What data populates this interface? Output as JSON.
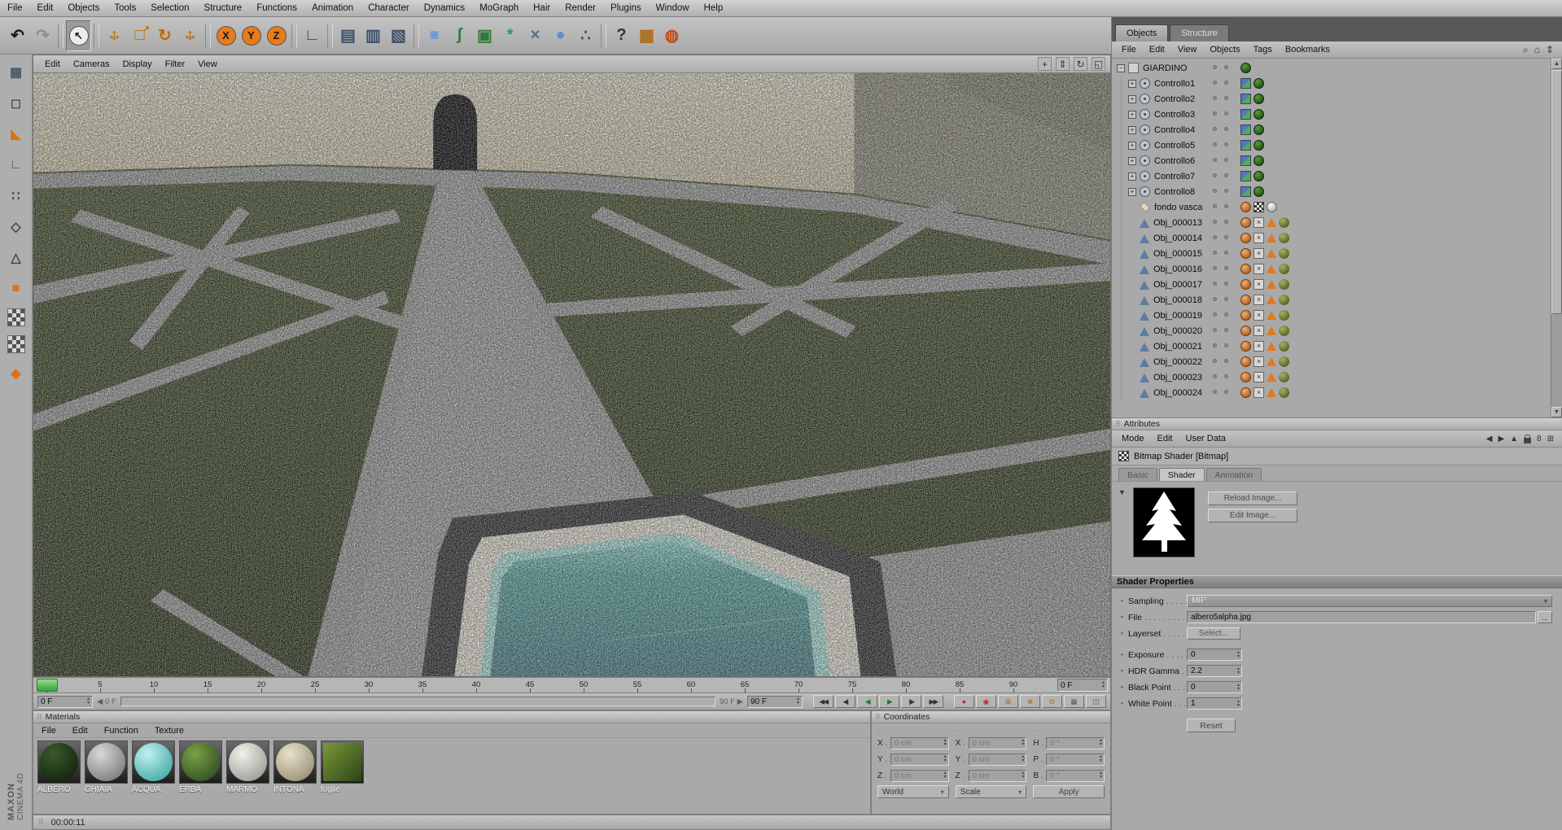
{
  "accent_colors": {
    "orange": "#e87b1a",
    "ui_gray": "#aeaeae",
    "playhead_green": "#62c862"
  },
  "menubar": {
    "items": [
      "File",
      "Edit",
      "Objects",
      "Tools",
      "Selection",
      "Structure",
      "Functions",
      "Animation",
      "Character",
      "Dynamics",
      "MoGraph",
      "Hair",
      "Render",
      "Plugins",
      "Window",
      "Help"
    ]
  },
  "toolbar": {
    "icons": [
      {
        "name": "undo-icon",
        "g": "↶",
        "fg": "#1a1a1a"
      },
      {
        "name": "redo-icon",
        "g": "↷",
        "fg": "#8d8d8d"
      },
      {
        "sep": true
      },
      {
        "name": "live-selection-tool",
        "g": "↖",
        "fg": "#1a1a1a",
        "circle": "#ececec",
        "sel": true
      },
      {
        "sep": true
      },
      {
        "name": "move-tool",
        "g": "↔",
        "g2": "↕",
        "fg": "#c26a00"
      },
      {
        "name": "scale-tool",
        "g": "□",
        "g2": "↗",
        "g2small": true,
        "fg": "#c26a00"
      },
      {
        "name": "rotate-tool",
        "g": "↻",
        "fg": "#c26a00"
      },
      {
        "name": "last-used-tool",
        "g": "↔",
        "g2": "↕",
        "fg": "#c26a00"
      },
      {
        "sep": true
      },
      {
        "name": "x-axis-lock",
        "g": "X",
        "fg": "#1a1a1a",
        "circle": "#e87b1a"
      },
      {
        "name": "y-axis-lock",
        "g": "Y",
        "fg": "#1a1a1a",
        "circle": "#e87b1a"
      },
      {
        "name": "z-axis-lock",
        "g": "Z",
        "fg": "#1a1a1a",
        "circle": "#e87b1a"
      },
      {
        "sep": true
      },
      {
        "name": "coordinate-system-toggle",
        "g": "∟",
        "fg": "#444444"
      },
      {
        "sep": true
      },
      {
        "name": "render-view-button",
        "g": "▤",
        "fg": "#3a506a"
      },
      {
        "name": "render-region-button",
        "g": "▥",
        "fg": "#3a506a"
      },
      {
        "name": "render-settings-button",
        "g": "▧",
        "fg": "#3a506a"
      },
      {
        "sep": true
      },
      {
        "name": "add-cube-object",
        "g": "■",
        "fg": "#6f9fd8"
      },
      {
        "name": "add-spline-object",
        "g": "ʃ",
        "fg": "#2f7a3a"
      },
      {
        "name": "add-subdivision-surface",
        "g": "▣",
        "fg": "#2f7a3a"
      },
      {
        "name": "add-mograph-object",
        "g": "*",
        "fg": "#2f9a4a"
      },
      {
        "name": "add-deformer-object",
        "g": "×",
        "fg": "#56707e"
      },
      {
        "name": "add-environment-object",
        "g": "●",
        "fg": "#5f8fc8"
      },
      {
        "name": "add-particle-emitter",
        "g": "∴",
        "fg": "#4a5a6a"
      },
      {
        "sep": true
      },
      {
        "name": "context-help-icon",
        "g": "?",
        "fg": "#333333"
      },
      {
        "name": "content-browser-icon",
        "g": "▦",
        "fg": "#b06a10"
      },
      {
        "name": "online-help-globe-icon",
        "g": "◍",
        "fg": "#c24a10"
      }
    ]
  },
  "sidebar": {
    "icons": [
      {
        "name": "make-editable-icon",
        "g": "▦",
        "fg": "#4a5a6a"
      },
      {
        "name": "model-mode-icon",
        "g": "◻",
        "fg": "#555555"
      },
      {
        "name": "texture-axis-mode-icon",
        "g": "◣",
        "fg": "#d8731a"
      },
      {
        "name": "workplane-mode-icon",
        "g": "∟",
        "fg": "#555555"
      },
      {
        "name": "point-mode-icon",
        "g": "∷",
        "fg": "#444455"
      },
      {
        "name": "edge-mode-icon",
        "g": "◇",
        "fg": "#444455"
      },
      {
        "name": "polygon-mode-icon",
        "g": "△",
        "fg": "#444455"
      },
      {
        "name": "object-axis-mode-icon",
        "g": "■",
        "fg": "#d8731a"
      },
      {
        "name": "texture-mode-icon",
        "checker": true
      },
      {
        "name": "uv-mode-icon",
        "checker": true
      },
      {
        "name": "snap-settings-icon",
        "g": "◆",
        "fg": "#d8731a"
      }
    ]
  },
  "viewport": {
    "menu": [
      "Edit",
      "Cameras",
      "Display",
      "Filter",
      "View"
    ],
    "camera_icons": [
      {
        "name": "camera-pan-icon",
        "g": "+"
      },
      {
        "name": "camera-zoom-icon",
        "g": "⇕"
      },
      {
        "name": "camera-rotate-icon",
        "g": "↻"
      },
      {
        "name": "viewport-layout-icon",
        "g": "◱"
      }
    ]
  },
  "timeline": {
    "tick_min": 0,
    "tick_max": 90,
    "tick_step": 5,
    "frame_field": "0 F",
    "range_start": "0 F",
    "range_start_ghost": "◀ 0 F",
    "range_end_ghost": "90 F ▶",
    "range_end": "90 F",
    "transport": [
      {
        "name": "goto-start-button",
        "g": "◀◀",
        "fg": "#333"
      },
      {
        "name": "prev-key-button",
        "g": "◀|",
        "fg": "#333"
      },
      {
        "name": "prev-frame-button",
        "g": "◀",
        "fg": "#1f7a1f"
      },
      {
        "name": "play-button",
        "g": "▶",
        "fg": "#1f7a1f"
      },
      {
        "name": "next-key-button",
        "g": "|▶",
        "fg": "#333"
      },
      {
        "name": "goto-end-button",
        "g": "▶▶",
        "fg": "#333"
      }
    ],
    "record_buttons": [
      {
        "name": "record-keyframe-button",
        "g": "●",
        "fg": "#c42222"
      },
      {
        "name": "autokey-button",
        "g": "◉",
        "fg": "#c42222"
      },
      {
        "name": "record-position-toggle",
        "g": "⊞",
        "fg": "#b06000"
      },
      {
        "name": "record-scale-toggle",
        "g": "⊕",
        "fg": "#b06000"
      },
      {
        "name": "record-rotation-toggle",
        "g": "⊙",
        "fg": "#b06000"
      },
      {
        "name": "record-parameter-toggle",
        "g": "▦",
        "fg": "#555"
      },
      {
        "name": "layout-toggle",
        "g": "◫",
        "fg": "#555"
      }
    ]
  },
  "materials": {
    "title": "Materials",
    "menu": [
      "File",
      "Edit",
      "Function",
      "Texture"
    ],
    "items": [
      {
        "name": "ALBERO",
        "c1": "#3a5a2a",
        "c2": "#0c1a08"
      },
      {
        "name": "GHIAIA",
        "c1": "#d8d8d8",
        "c2": "#6a6a6a"
      },
      {
        "name": "ACQUA",
        "c1": "#bff2ee",
        "c2": "#2f9a9a"
      },
      {
        "name": "ERBA",
        "c1": "#7aa045",
        "c2": "#24401a"
      },
      {
        "name": "MARMO",
        "c1": "#f2f0ea",
        "c2": "#8c8c84"
      },
      {
        "name": "INTONA",
        "c1": "#e8e0c8",
        "c2": "#8a8268"
      },
      {
        "name": "foglie",
        "flat": true,
        "c1": "#7a9a3a",
        "c2": "#2c4416"
      }
    ]
  },
  "coordinates": {
    "title": "Coordinates",
    "dash": "–",
    "rows": [
      {
        "pos": "X",
        "pos_v": "0 cm",
        "size": "X",
        "size_v": "0 cm",
        "rot": "H",
        "rot_v": "0 °"
      },
      {
        "pos": "Y",
        "pos_v": "0 cm",
        "size": "Y",
        "size_v": "0 cm",
        "rot": "P",
        "rot_v": "0 °"
      },
      {
        "pos": "Z",
        "pos_v": "0 cm",
        "size": "Z",
        "size_v": "0 cm",
        "rot": "B",
        "rot_v": "0 °"
      }
    ],
    "space": "World",
    "mode": "Scale",
    "apply": "Apply"
  },
  "objects_panel": {
    "tabs": [
      {
        "label": "Objects",
        "active": true
      },
      {
        "label": "Structure",
        "active": false
      }
    ],
    "menu": [
      "File",
      "Edit",
      "View",
      "Objects",
      "Tags",
      "Bookmarks"
    ],
    "menu_icons": [
      {
        "name": "search-icon",
        "g": "⌕"
      },
      {
        "name": "home-icon",
        "g": "⌂"
      },
      {
        "name": "collapse-icon",
        "g": "⇕"
      }
    ],
    "tree": [
      {
        "name": "GIARDINO",
        "level": 0,
        "exp": "−",
        "icon": "group",
        "tags": [
          "green"
        ]
      },
      {
        "name": "Controllo1",
        "level": 1,
        "exp": "+",
        "icon": "null",
        "tags": [
          "xp",
          "green"
        ]
      },
      {
        "name": "Controllo2",
        "level": 1,
        "exp": "+",
        "icon": "null",
        "tags": [
          "xp",
          "green"
        ]
      },
      {
        "name": "Controllo3",
        "level": 1,
        "exp": "+",
        "icon": "null",
        "tags": [
          "xp",
          "green"
        ]
      },
      {
        "name": "Controllo4",
        "level": 1,
        "exp": "+",
        "icon": "null",
        "tags": [
          "xp",
          "green"
        ]
      },
      {
        "name": "Controllo5",
        "level": 1,
        "exp": "+",
        "icon": "null",
        "tags": [
          "xp",
          "green"
        ]
      },
      {
        "name": "Controllo6",
        "level": 1,
        "exp": "+",
        "icon": "null",
        "tags": [
          "xp",
          "green"
        ]
      },
      {
        "name": "Controllo7",
        "level": 1,
        "exp": "+",
        "icon": "null",
        "tags": [
          "xp",
          "green"
        ]
      },
      {
        "name": "Controllo8",
        "level": 1,
        "exp": "+",
        "icon": "null",
        "tags": [
          "xp",
          "green"
        ]
      },
      {
        "name": "fondo vasca",
        "level": 1,
        "exp": "",
        "icon": "plane",
        "tags": [
          "phong",
          "chk",
          "wball"
        ]
      },
      {
        "name": "Obj_000013",
        "level": 1,
        "exp": "",
        "icon": "poly",
        "tags": [
          "phong",
          "x",
          "tri",
          "tball"
        ]
      },
      {
        "name": "Obj_000014",
        "level": 1,
        "exp": "",
        "icon": "poly",
        "tags": [
          "phong",
          "x",
          "tri",
          "tball"
        ]
      },
      {
        "name": "Obj_000015",
        "level": 1,
        "exp": "",
        "icon": "poly",
        "tags": [
          "phong",
          "x",
          "tri",
          "tball"
        ]
      },
      {
        "name": "Obj_000016",
        "level": 1,
        "exp": "",
        "icon": "poly",
        "tags": [
          "phong",
          "x",
          "tri",
          "tball"
        ]
      },
      {
        "name": "Obj_000017",
        "level": 1,
        "exp": "",
        "icon": "poly",
        "tags": [
          "phong",
          "x",
          "tri",
          "tball"
        ]
      },
      {
        "name": "Obj_000018",
        "level": 1,
        "exp": "",
        "icon": "poly",
        "tags": [
          "phong",
          "x",
          "tri",
          "tball"
        ]
      },
      {
        "name": "Obj_000019",
        "level": 1,
        "exp": "",
        "icon": "poly",
        "tags": [
          "phong",
          "x",
          "tri",
          "tball"
        ]
      },
      {
        "name": "Obj_000020",
        "level": 1,
        "exp": "",
        "icon": "poly",
        "tags": [
          "phong",
          "x",
          "tri",
          "tball"
        ]
      },
      {
        "name": "Obj_000021",
        "level": 1,
        "exp": "",
        "icon": "poly",
        "tags": [
          "phong",
          "x",
          "tri",
          "tball"
        ]
      },
      {
        "name": "Obj_000022",
        "level": 1,
        "exp": "",
        "icon": "poly",
        "tags": [
          "phong",
          "x",
          "tri",
          "tball"
        ]
      },
      {
        "name": "Obj_000023",
        "level": 1,
        "exp": "",
        "icon": "poly",
        "tags": [
          "phong",
          "x",
          "tri",
          "tball"
        ]
      },
      {
        "name": "Obj_000024",
        "level": 1,
        "exp": "",
        "icon": "poly",
        "tags": [
          "phong",
          "x",
          "tri",
          "tball"
        ]
      }
    ]
  },
  "attributes": {
    "title": "Attributes",
    "menu": [
      "Mode",
      "Edit",
      "User Data"
    ],
    "menu_icons": [
      {
        "name": "history-back-icon",
        "g": "◀"
      },
      {
        "name": "history-forward-icon",
        "g": "▶"
      },
      {
        "name": "pin-icon",
        "g": "▲"
      },
      {
        "name": "lock-icon",
        "g": "lock"
      },
      {
        "name": "link-icon",
        "g": "8"
      },
      {
        "name": "expand-icon",
        "g": "⊞"
      }
    ],
    "shader_title": "Bitmap Shader [Bitmap]",
    "tabs": [
      {
        "label": "Basic",
        "active": false
      },
      {
        "label": "Shader",
        "active": true
      },
      {
        "label": "Animation",
        "active": false
      }
    ],
    "reload_button": "Reload Image...",
    "edit_button": "Edit Image...",
    "section": "Shader Properties",
    "props": [
      {
        "label": "Sampling",
        "type": "dropdown",
        "value": "MIP"
      },
      {
        "label": "File",
        "type": "file",
        "value": "albero5alpha.jpg",
        "browse": "..."
      },
      {
        "label": "Layerset",
        "type": "button",
        "value": "Select..."
      },
      {
        "label": "Exposure",
        "type": "number",
        "value": "0",
        "gap": true
      },
      {
        "label": "HDR Gamma",
        "type": "number",
        "value": "2.2"
      },
      {
        "label": "Black Point",
        "type": "number",
        "value": "0"
      },
      {
        "label": "White Point",
        "type": "number",
        "value": "1"
      }
    ],
    "reset_button": "Reset"
  },
  "statusbar": {
    "time": "00:00:11"
  },
  "branding": {
    "line1": "MAXON",
    "line2": "CINEMA 4D"
  }
}
